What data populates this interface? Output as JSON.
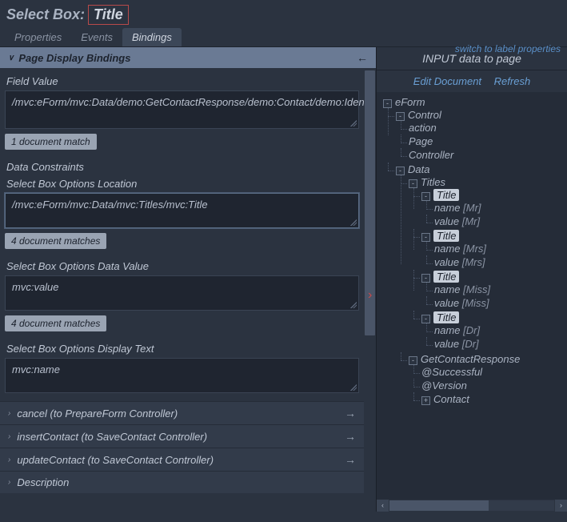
{
  "header": {
    "prefix": "Select Box:",
    "value": "Title"
  },
  "tabs": {
    "properties": "Properties",
    "events": "Events",
    "bindings": "Bindings"
  },
  "switch_link": "switch to label properties",
  "left": {
    "section_title": "Page Display Bindings",
    "field_value_label": "Field Value",
    "field_value": "/mvc:eForm/mvc:Data/demo:GetContactResponse/demo:Contact/demo:IdentificationDetails/demo:Title",
    "field_value_match": "1 document match",
    "data_constraints_label": "Data Constraints",
    "options_location_label": "Select Box Options Location",
    "options_location": "/mvc:eForm/mvc:Data/mvc:Titles/mvc:Title",
    "options_location_match": "4 document matches",
    "options_data_value_label": "Select Box Options Data Value",
    "options_data_value": "mvc:value",
    "options_data_value_match": "4 document matches",
    "options_display_text_label": "Select Box Options Display Text",
    "options_display_text": "mvc:name",
    "extra_bindings": [
      {
        "label": "cancel (to PrepareForm Controller)"
      },
      {
        "label": "insertContact (to SaveContact Controller)"
      },
      {
        "label": "updateContact (to SaveContact Controller)"
      }
    ],
    "description_label": "Description"
  },
  "right": {
    "header": "INPUT data to page",
    "edit_document": "Edit Document",
    "refresh": "Refresh",
    "tree": {
      "eForm": "eForm",
      "control": "Control",
      "control_children": [
        "action",
        "Page",
        "Controller"
      ],
      "data": "Data",
      "titles": "Titles",
      "title_node": "Title",
      "name_prefix": "name",
      "value_prefix": "value",
      "title_entries": [
        {
          "name": "Mr",
          "value": "Mr"
        },
        {
          "name": "Mrs",
          "value": "Mrs"
        },
        {
          "name": "Miss",
          "value": "Miss"
        },
        {
          "name": "Dr",
          "value": "Dr"
        }
      ],
      "getcontact": "GetContactResponse",
      "successful": "@Successful",
      "version": "@Version",
      "contact": "Contact"
    }
  }
}
